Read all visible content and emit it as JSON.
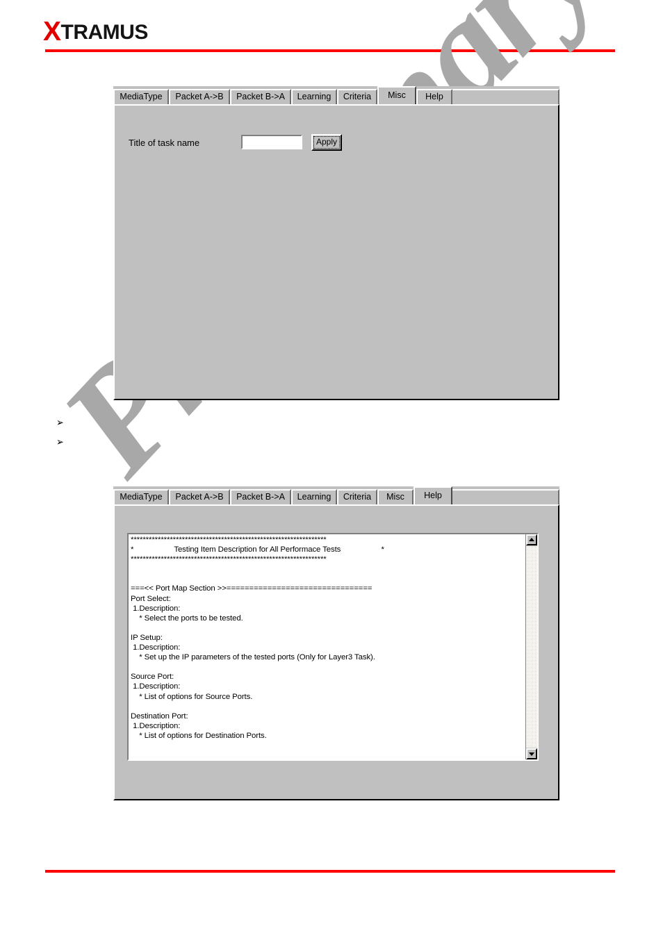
{
  "header": {
    "logo_x": "X",
    "logo_rest": "TRAMUS",
    "accent_color": "#ff0000"
  },
  "watermark": {
    "text": "Preliminary",
    "color": "#a8a8a8"
  },
  "panel_one": {
    "tabs": [
      {
        "label": "MediaType",
        "selected": false
      },
      {
        "label": "Packet A->B",
        "selected": false
      },
      {
        "label": "Packet B->A",
        "selected": false
      },
      {
        "label": "Learning",
        "selected": false
      },
      {
        "label": "Criteria",
        "selected": false
      },
      {
        "label": "Misc",
        "selected": true
      },
      {
        "label": "Help",
        "selected": false
      }
    ],
    "task_name_label": "Title of task name",
    "task_name_value": "",
    "task_name_placeholder": "",
    "apply_label": "Apply"
  },
  "bullets": [
    {
      "marker": "➢",
      "text": ""
    },
    {
      "marker": "➢",
      "text": ""
    }
  ],
  "panel_two": {
    "tabs": [
      {
        "label": "MediaType",
        "selected": false
      },
      {
        "label": "Packet A->B",
        "selected": false
      },
      {
        "label": "Packet B->A",
        "selected": false
      },
      {
        "label": "Learning",
        "selected": false
      },
      {
        "label": "Criteria",
        "selected": false
      },
      {
        "label": "Misc",
        "selected": false
      },
      {
        "label": "Help",
        "selected": true
      }
    ],
    "help_text": "*****************************************************************\n*                   Testing Item Description for All Performace Tests                   *\n*****************************************************************\n\n\n===<< Port Map Section >>================================\nPort Select:\n 1.Description:\n    * Select the ports to be tested.\n\nIP Setup:\n 1.Description:\n    * Set up the IP parameters of the tested ports (Only for Layer3 Task).\n\nSource Port:\n 1.Description:\n    * List of options for Source Ports.\n\nDestination Port:\n 1.Description:\n    * List of options for Destination Ports.",
    "scrollbar": {
      "up_arrow": "scroll-up-arrow",
      "down_arrow": "scroll-down-arrow",
      "thumb_position_percent": 0
    }
  }
}
